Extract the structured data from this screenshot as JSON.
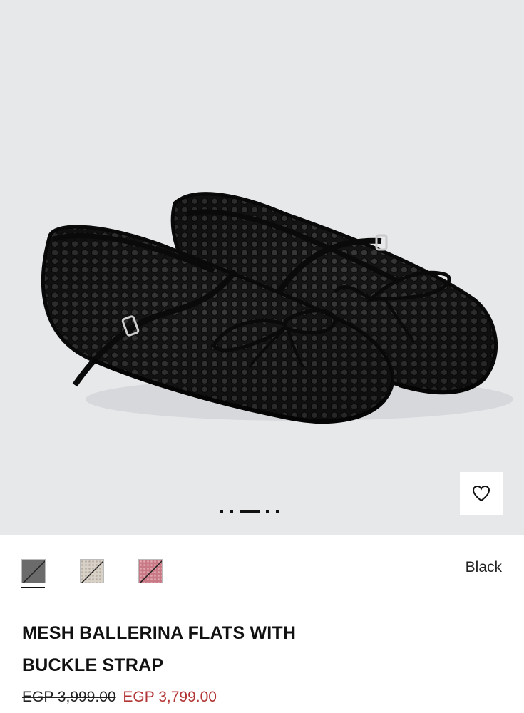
{
  "product": {
    "title_line1": "MESH BALLERINA FLATS WITH",
    "title_line2": "BUCKLE STRAP",
    "old_price": "EGP 3,999.00",
    "new_price": "EGP 3,799.00",
    "selected_color": "Black"
  },
  "gallery": {
    "image_subject": "Pair of black mesh ballerina flats with buckle strap and bow",
    "background_color": "#e6e8ea",
    "active_slide": 3,
    "total_slides": 6,
    "wishlist_icon": "heart-outline-icon"
  },
  "swatches": [
    {
      "name": "black-gray",
      "color": "#6b6b6b",
      "selected": true,
      "strikethrough": true
    },
    {
      "name": "beige-mesh",
      "color": "#cfc7bd",
      "selected": false,
      "strikethrough": true
    },
    {
      "name": "pink",
      "color": "#c97985",
      "selected": false,
      "strikethrough": true
    }
  ],
  "colors": {
    "accent_sale": "#b23434",
    "text": "#111111"
  }
}
